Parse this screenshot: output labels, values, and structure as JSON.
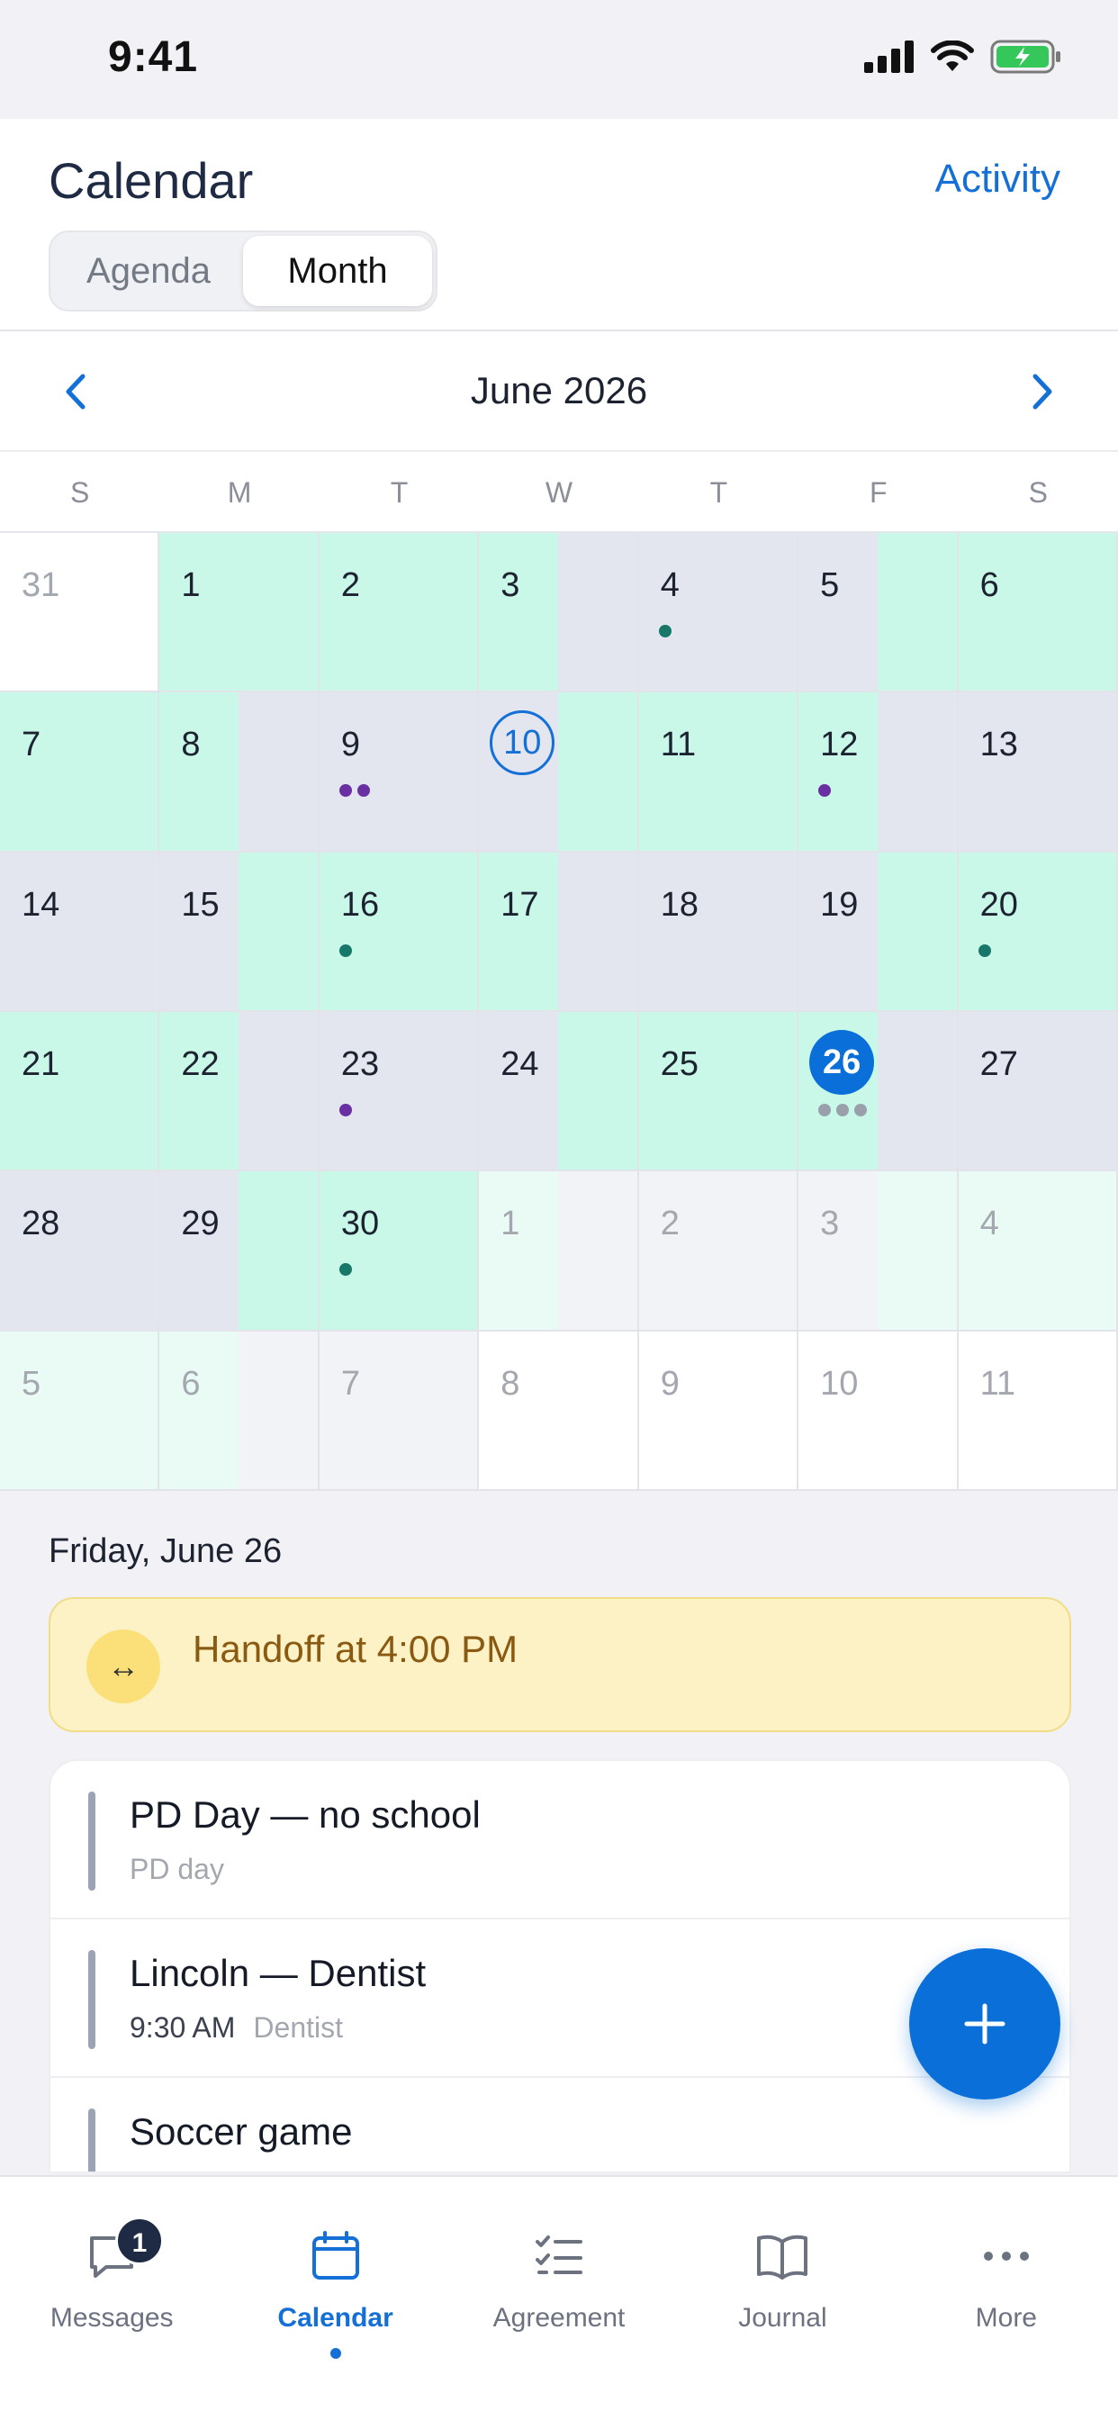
{
  "status_bar": {
    "time": "9:41"
  },
  "header": {
    "title": "Calendar",
    "activity": "Activity",
    "segments": [
      "Agenda",
      "Month"
    ],
    "active_segment": "Month"
  },
  "month_nav": {
    "label": "June 2026"
  },
  "weekdays": [
    "S",
    "M",
    "T",
    "W",
    "T",
    "F",
    "S"
  ],
  "colors": {
    "green": "#c9f7e8",
    "gray": "#e3e6ee",
    "green_muted": "#eafbf6",
    "gray_muted": "#f2f3f6",
    "white": "#ffffff",
    "dot_teal": "#17786a",
    "dot_purple": "#6a2fa3",
    "dot_gray": "#9aa0ab",
    "accent": "#1470d6"
  },
  "calendar": {
    "weeks": [
      [
        {
          "d": "31",
          "muted": true,
          "l": "white",
          "r": "white"
        },
        {
          "d": "1",
          "l": "green",
          "r": "green"
        },
        {
          "d": "2",
          "l": "green",
          "r": "green"
        },
        {
          "d": "3",
          "l": "green",
          "r": "gray"
        },
        {
          "d": "4",
          "l": "gray",
          "r": "gray",
          "dots": [
            "dot_teal"
          ]
        },
        {
          "d": "5",
          "l": "gray",
          "r": "green"
        },
        {
          "d": "6",
          "l": "green",
          "r": "green"
        }
      ],
      [
        {
          "d": "7",
          "l": "green",
          "r": "green"
        },
        {
          "d": "8",
          "l": "green",
          "r": "gray"
        },
        {
          "d": "9",
          "l": "gray",
          "r": "gray",
          "dots": [
            "dot_purple",
            "dot_purple"
          ]
        },
        {
          "d": "10",
          "today": true,
          "l": "gray",
          "r": "green"
        },
        {
          "d": "11",
          "l": "green",
          "r": "green"
        },
        {
          "d": "12",
          "l": "green",
          "r": "gray",
          "dots": [
            "dot_purple"
          ]
        },
        {
          "d": "13",
          "l": "gray",
          "r": "gray"
        }
      ],
      [
        {
          "d": "14",
          "l": "gray",
          "r": "gray"
        },
        {
          "d": "15",
          "l": "gray",
          "r": "green"
        },
        {
          "d": "16",
          "l": "green",
          "r": "green",
          "dots": [
            "dot_teal"
          ]
        },
        {
          "d": "17",
          "l": "green",
          "r": "gray"
        },
        {
          "d": "18",
          "l": "gray",
          "r": "gray"
        },
        {
          "d": "19",
          "l": "gray",
          "r": "green"
        },
        {
          "d": "20",
          "l": "green",
          "r": "green",
          "dots": [
            "dot_teal"
          ]
        }
      ],
      [
        {
          "d": "21",
          "l": "green",
          "r": "green"
        },
        {
          "d": "22",
          "l": "green",
          "r": "gray"
        },
        {
          "d": "23",
          "l": "gray",
          "r": "gray",
          "dots": [
            "dot_purple"
          ]
        },
        {
          "d": "24",
          "l": "gray",
          "r": "green"
        },
        {
          "d": "25",
          "l": "green",
          "r": "green"
        },
        {
          "d": "26",
          "selected": true,
          "l": "green",
          "r": "gray",
          "dots": [
            "dot_gray",
            "dot_gray",
            "dot_gray"
          ]
        },
        {
          "d": "27",
          "l": "gray",
          "r": "gray"
        }
      ],
      [
        {
          "d": "28",
          "l": "gray",
          "r": "gray"
        },
        {
          "d": "29",
          "l": "gray",
          "r": "green"
        },
        {
          "d": "30",
          "l": "green",
          "r": "green",
          "dots": [
            "dot_teal"
          ]
        },
        {
          "d": "1",
          "muted": true,
          "l": "green_muted",
          "r": "gray_muted"
        },
        {
          "d": "2",
          "muted": true,
          "l": "gray_muted",
          "r": "gray_muted"
        },
        {
          "d": "3",
          "muted": true,
          "l": "gray_muted",
          "r": "green_muted"
        },
        {
          "d": "4",
          "muted": true,
          "l": "green_muted",
          "r": "green_muted"
        }
      ],
      [
        {
          "d": "5",
          "muted": true,
          "l": "green_muted",
          "r": "green_muted"
        },
        {
          "d": "6",
          "muted": true,
          "l": "green_muted",
          "r": "gray_muted"
        },
        {
          "d": "7",
          "muted": true,
          "l": "gray_muted",
          "r": "gray_muted"
        },
        {
          "d": "8",
          "muted": true,
          "l": "white",
          "r": "white"
        },
        {
          "d": "9",
          "muted": true,
          "l": "white",
          "r": "white"
        },
        {
          "d": "10",
          "muted": true,
          "l": "white",
          "r": "white"
        },
        {
          "d": "11",
          "muted": true,
          "l": "white",
          "r": "white"
        }
      ]
    ]
  },
  "day_detail": {
    "title": "Friday, June 26",
    "handoff_icon": "↔",
    "handoff_text": "Handoff at 4:00 PM",
    "events": [
      {
        "title": "PD Day — no school",
        "time": "",
        "sub": "PD day"
      },
      {
        "title": "Lincoln — Dentist",
        "time": "9:30 AM",
        "sub": "Dentist"
      },
      {
        "title": "Soccer game",
        "time": "",
        "sub": ""
      }
    ]
  },
  "fab": {
    "icon": "plus-icon"
  },
  "tabbar": {
    "tabs": [
      {
        "label": "Messages",
        "icon": "message-icon",
        "badge": "1"
      },
      {
        "label": "Calendar",
        "icon": "calendar-icon",
        "active": true
      },
      {
        "label": "Agreement",
        "icon": "checklist-icon"
      },
      {
        "label": "Journal",
        "icon": "book-icon"
      },
      {
        "label": "More",
        "icon": "more-icon"
      }
    ]
  }
}
